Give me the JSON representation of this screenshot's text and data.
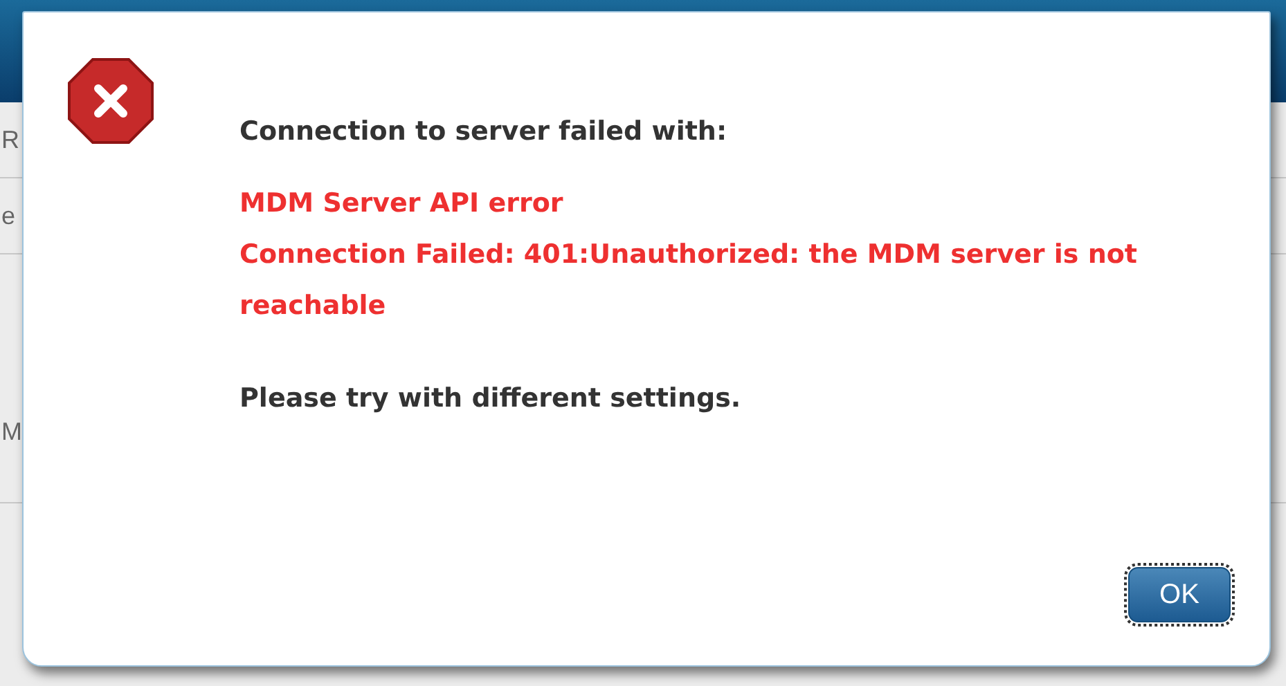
{
  "background": {
    "row_labels": [
      "R",
      "e",
      "M"
    ]
  },
  "dialog": {
    "heading": "Connection to server failed with:",
    "error_lines": [
      "MDM Server API error",
      "Connection Failed: 401:Unauthorized: the MDM server is not reachable"
    ],
    "footer": "Please try with different settings.",
    "ok_button": {
      "label": "OK",
      "focused": true
    }
  }
}
